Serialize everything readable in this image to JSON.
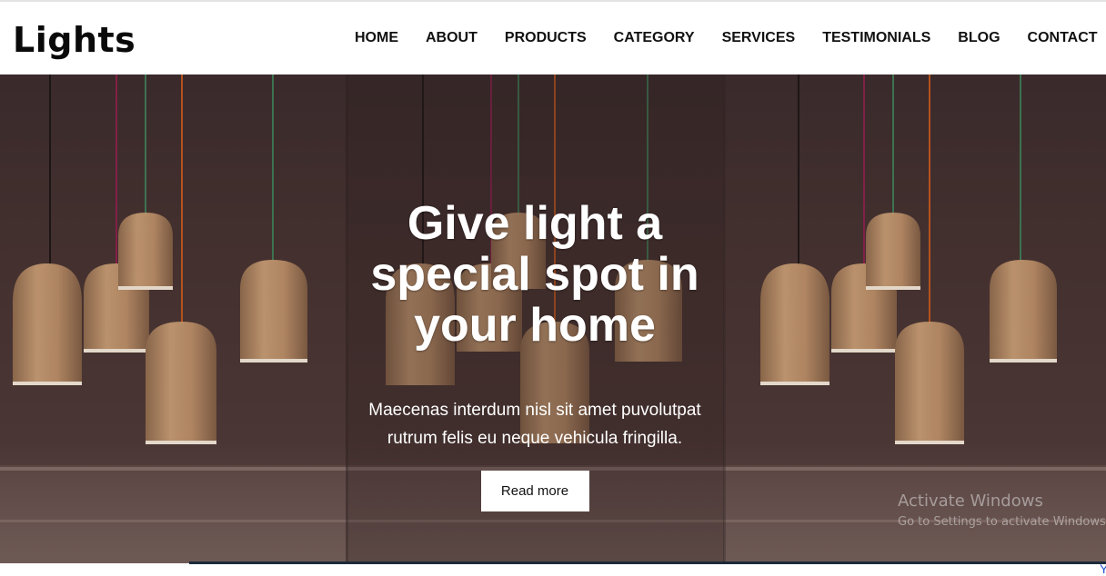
{
  "brand": {
    "logo": "Lights"
  },
  "nav": {
    "items": [
      {
        "label": "HOME"
      },
      {
        "label": "ABOUT"
      },
      {
        "label": "PRODUCTS"
      },
      {
        "label": "CATEGORY"
      },
      {
        "label": "SERVICES"
      },
      {
        "label": "TESTIMONIALS"
      },
      {
        "label": "BLOG"
      },
      {
        "label": "CONTACT"
      }
    ]
  },
  "hero": {
    "title": "Give light a special spot in your home",
    "description": "Maecenas interdum nisl sit amet puvolutpat rutrum felis eu neque vehicula fringilla.",
    "cta_label": "Read more"
  },
  "watermark": {
    "title": "Activate Windows",
    "subtitle": "Go to Settings to activate Windows."
  },
  "corner_text": "Y",
  "colors": {
    "header_bg": "#ffffff",
    "nav_text": "#111111",
    "hero_overlay": "#3f2e2e",
    "lamp_shade": "#c99a6e",
    "button_bg": "#ffffff"
  }
}
